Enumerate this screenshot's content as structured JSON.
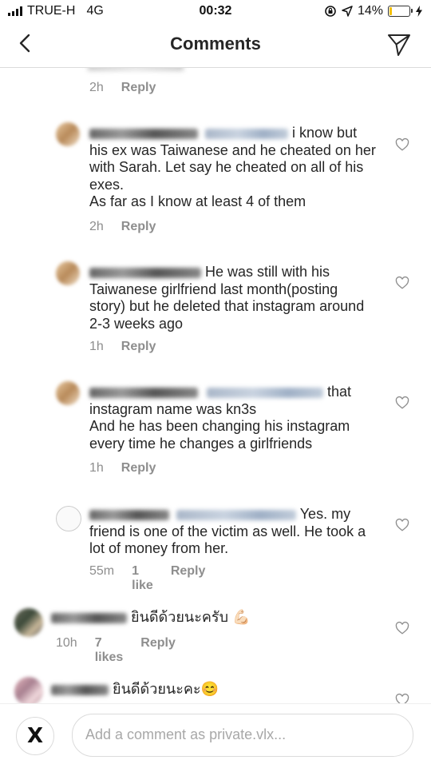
{
  "status_bar": {
    "carrier": "TRUE-H",
    "network": "4G",
    "time": "00:32",
    "battery": "14%",
    "battery_level": 0.14
  },
  "header": {
    "title": "Comments"
  },
  "comments": [
    {
      "time": "2h",
      "reply_label": "Reply"
    },
    {
      "text": "i know but his ex was Taiwanese and he cheated on her with Sarah. Let say he cheated on all of his exes.",
      "text2": "As far as I know at least 4 of them",
      "time": "2h",
      "reply_label": "Reply"
    },
    {
      "text": "He was still with his Taiwanese girlfriend last month(posting story) but he deleted that instagram around 2-3 weeks ago",
      "time": "1h",
      "reply_label": "Reply"
    },
    {
      "text": "that instagram name was kn3s",
      "text2": "And he has been changing his instagram every time he changes a girlfriends",
      "time": "1h",
      "reply_label": "Reply"
    },
    {
      "text": "Yes. my friend is one of the victim as well. He took a lot of money from her.",
      "time": "55m",
      "likes": "1 like",
      "reply_label": "Reply"
    },
    {
      "text": "ยินดีด้วยนะครับ 💪🏻",
      "time": "10h",
      "likes": "7 likes",
      "reply_label": "Reply"
    },
    {
      "text": "ยินดีด้วยนะคะ😊"
    }
  ],
  "composer": {
    "placeholder": "Add a comment as private.vlx...",
    "avatar_letter": "X"
  },
  "colors": {
    "text": "#262626",
    "meta": "#8e8e8e",
    "border": "#dbdbdb",
    "battery": "#f5c000"
  }
}
